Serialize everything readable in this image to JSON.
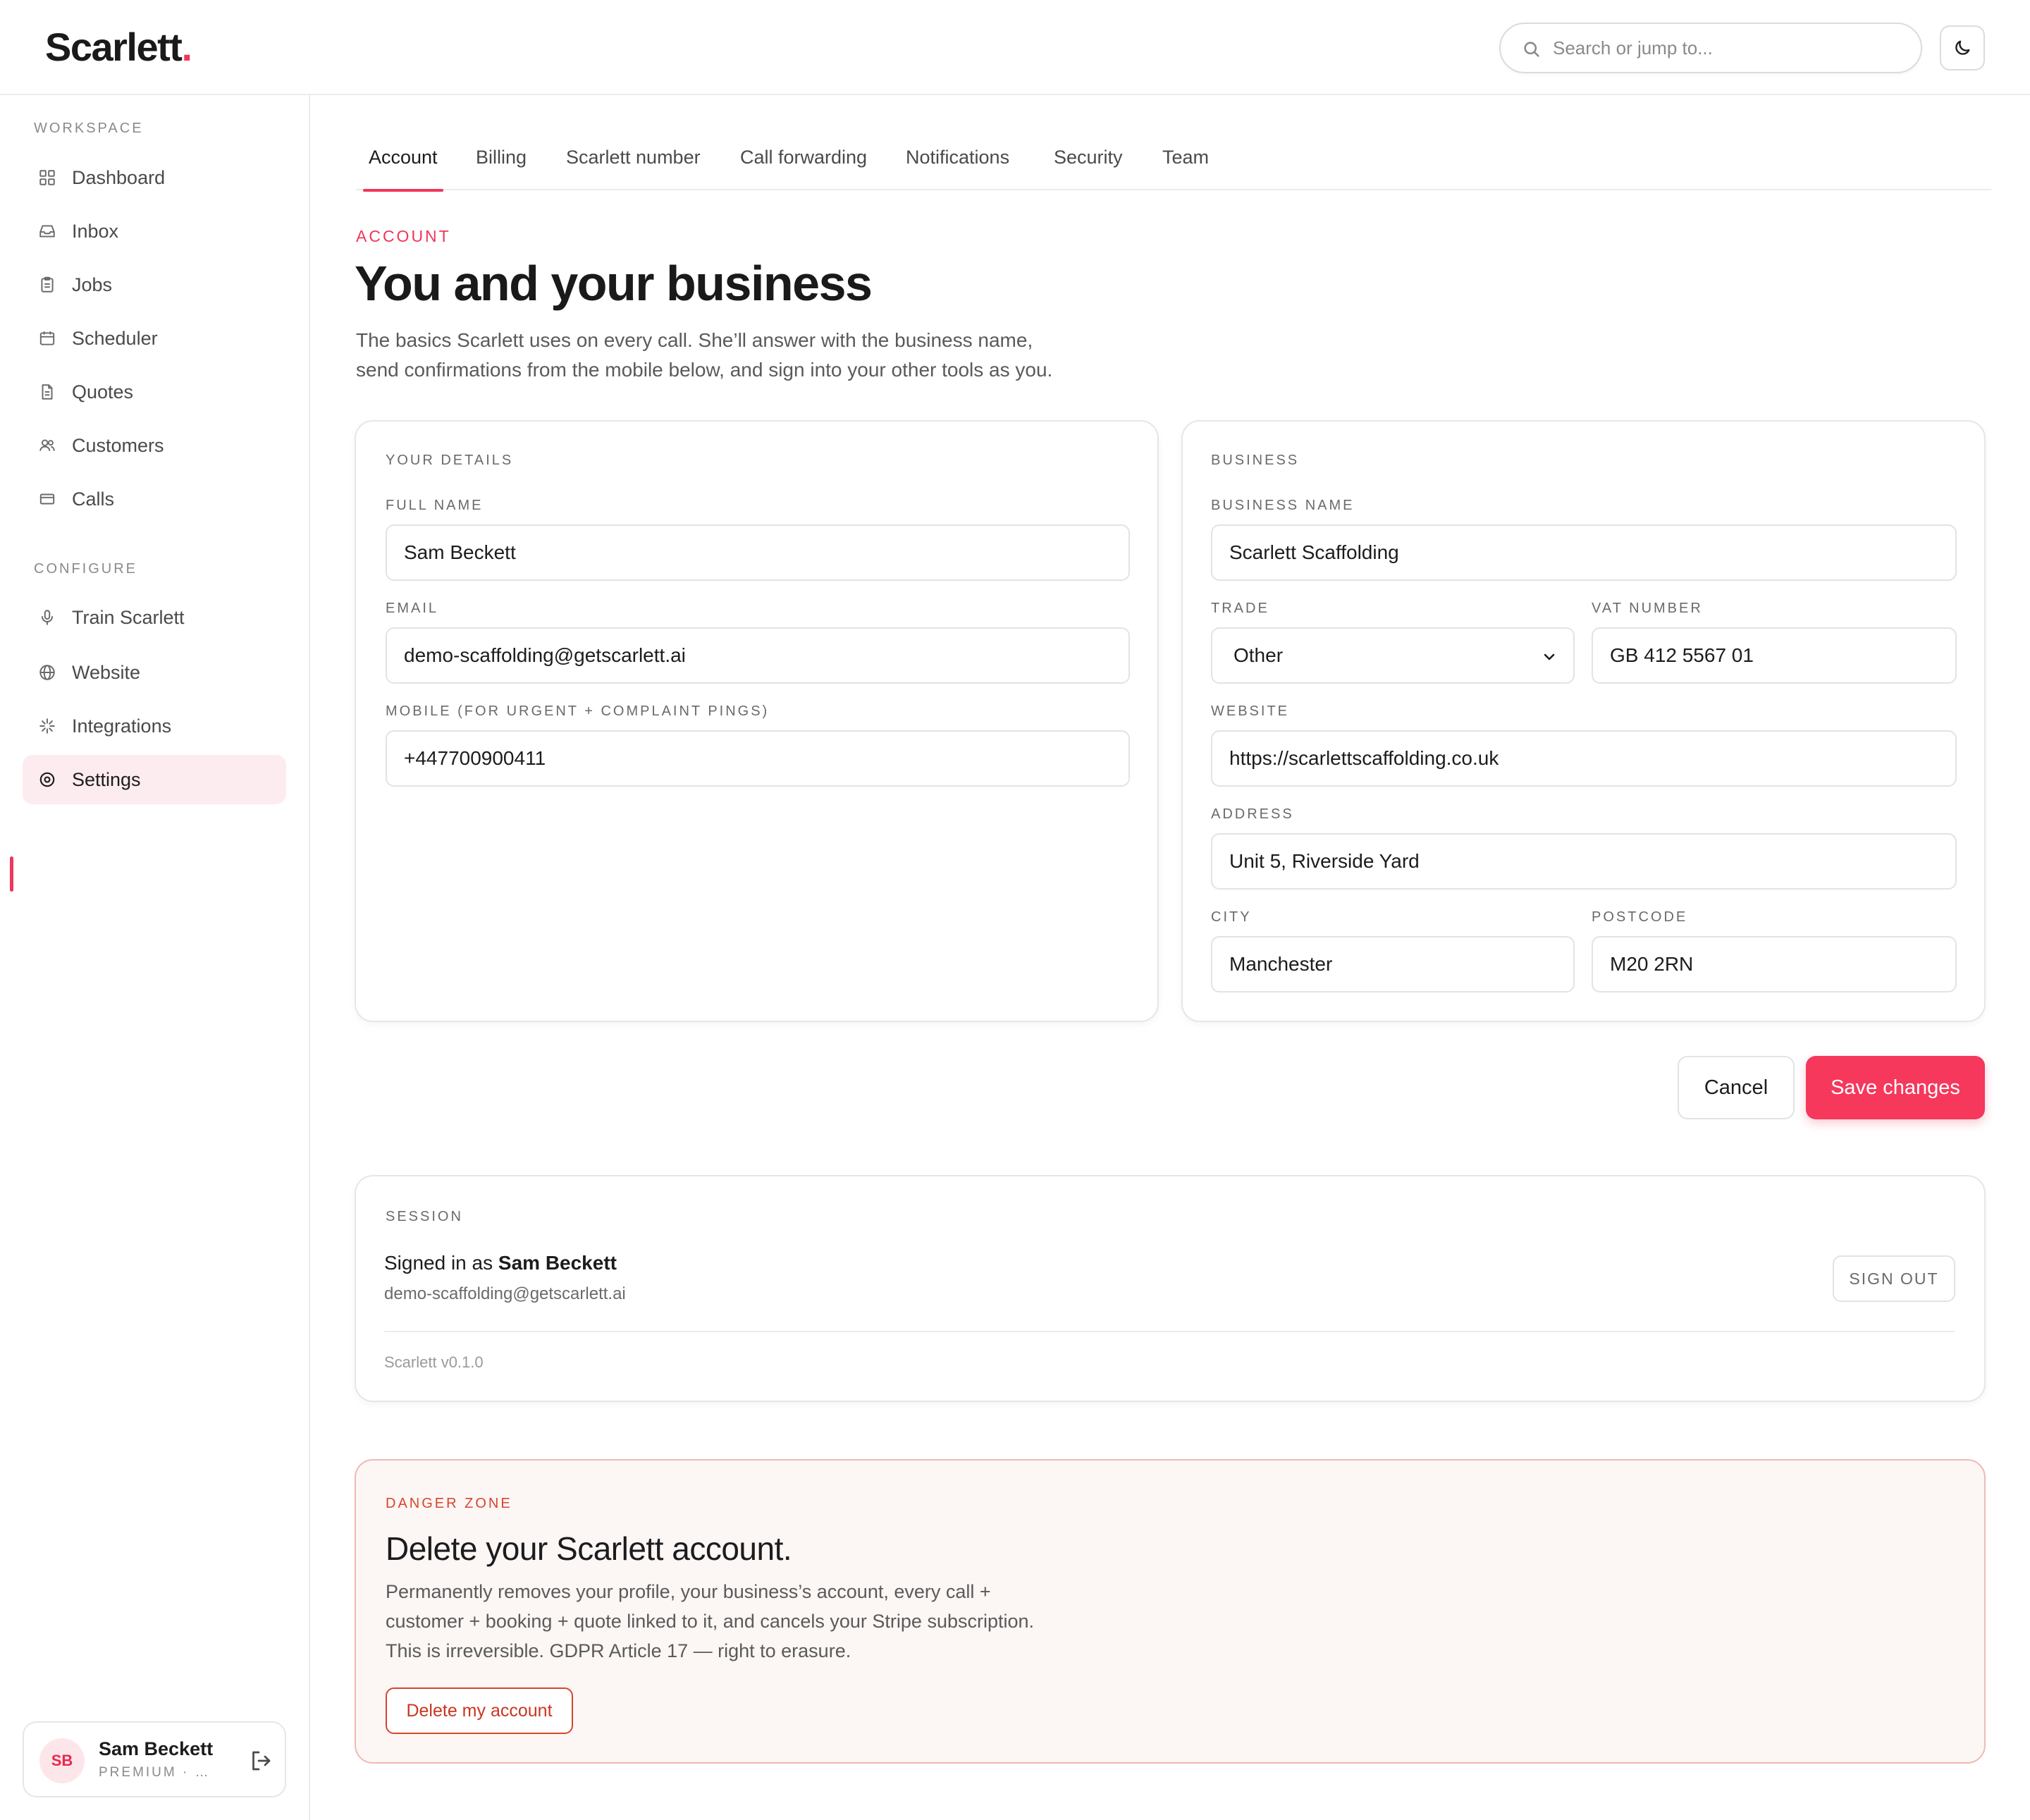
{
  "app": {
    "logo_text": "Scarlett",
    "logo_dot": ".",
    "accent_color": "#f0365a"
  },
  "header": {
    "search_placeholder": "Search or jump to...",
    "theme_toggle_icon": "moon-icon"
  },
  "sidebar": {
    "workspace_label": "WORKSPACE",
    "workspace_items": [
      {
        "label": "Dashboard",
        "icon": "grid-icon"
      },
      {
        "label": "Inbox",
        "icon": "inbox-icon"
      },
      {
        "label": "Jobs",
        "icon": "clipboard-icon"
      },
      {
        "label": "Scheduler",
        "icon": "calendar-icon"
      },
      {
        "label": "Quotes",
        "icon": "document-icon"
      },
      {
        "label": "Customers",
        "icon": "users-icon"
      },
      {
        "label": "Calls",
        "icon": "calls-icon"
      }
    ],
    "configure_label": "CONFIGURE",
    "configure_items": [
      {
        "label": "Train Scarlett",
        "icon": "microphone-icon"
      },
      {
        "label": "Website",
        "icon": "globe-icon"
      },
      {
        "label": "Integrations",
        "icon": "sparkle-icon"
      },
      {
        "label": "Settings",
        "icon": "settings-icon",
        "active": true
      }
    ],
    "user": {
      "initials": "SB",
      "name": "Sam Beckett",
      "plan": "PREMIUM · SCARLETT SCAFFOLDING"
    }
  },
  "tabs": [
    {
      "label": "Account",
      "active": true
    },
    {
      "label": "Billing"
    },
    {
      "label": "Scarlett number"
    },
    {
      "label": "Call forwarding"
    },
    {
      "label": "Notifications"
    },
    {
      "label": "Security"
    },
    {
      "label": "Team"
    }
  ],
  "page": {
    "eyebrow": "ACCOUNT",
    "title": "You and your business",
    "intro_line1": "The basics Scarlett uses on every call. She’ll answer with the business name,",
    "intro_line2": "send confirmations from the mobile below, and sign into your other tools as you."
  },
  "your_details": {
    "heading": "YOUR DETAILS",
    "full_name_label": "FULL NAME",
    "full_name": "Sam Beckett",
    "email_label": "EMAIL",
    "email": "demo-scaffolding@getscarlett.ai",
    "mobile_label": "MOBILE (FOR URGENT + COMPLAINT PINGS)",
    "mobile": "+447700900411"
  },
  "business": {
    "heading": "BUSINESS",
    "name_label": "BUSINESS NAME",
    "name": "Scarlett Scaffolding",
    "trade_label": "TRADE",
    "trade": "Other",
    "vat_label": "VAT NUMBER",
    "vat": "GB 412 5567 01",
    "website_label": "WEBSITE",
    "website": "https://scarlettscaffolding.co.uk",
    "address_label": "ADDRESS",
    "address": "Unit 5, Riverside Yard",
    "city_label": "CITY",
    "city": "Manchester",
    "postcode_label": "POSTCODE",
    "postcode": "M20 2RN"
  },
  "actions": {
    "cancel": "Cancel",
    "save": "Save changes"
  },
  "session": {
    "heading": "SESSION",
    "signed_in_prefix": "Signed in as ",
    "signed_in_name": "Sam Beckett",
    "email": "demo-scaffolding@getscarlett.ai",
    "sign_out": "SIGN OUT",
    "version": "Scarlett v0.1.0"
  },
  "danger": {
    "heading": "DANGER ZONE",
    "title": "Delete your Scarlett account.",
    "line1": "Permanently removes your profile, your business’s account, every call +",
    "line2": "customer + booking + quote linked to it, and cancels your Stripe subscription.",
    "line3": "This is irreversible. GDPR Article 17 — right to erasure.",
    "button": "Delete my account"
  }
}
